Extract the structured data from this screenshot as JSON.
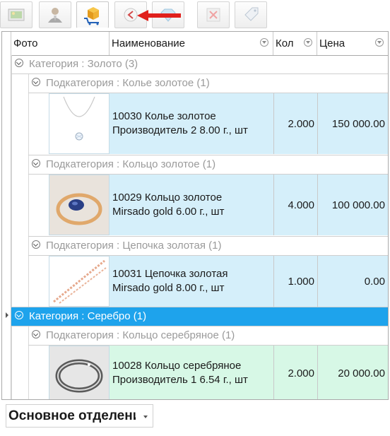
{
  "toolbar": {
    "buttons": [
      {
        "icon": "image-icon"
      },
      {
        "icon": "user-icon"
      },
      {
        "icon": "cart-box-icon",
        "active": true
      },
      {
        "icon": "back-icon"
      },
      {
        "icon": "diamond-icon"
      },
      {
        "icon": "delete-icon"
      },
      {
        "icon": "price-tag-icon"
      }
    ]
  },
  "grid": {
    "columns": [
      "Фото",
      "Наименование",
      "Кол",
      "Цена"
    ],
    "groups": [
      {
        "label": "Категория : Золото (3)",
        "selected": false,
        "subgroups": [
          {
            "label": "Подкатегория : Колье золотое (1)",
            "item": {
              "line1": "10030 Колье золотое",
              "line2": "Производитель 2 8.00 г., шт",
              "qty": "2.000",
              "price": "150 000.00",
              "image": "necklace-image"
            }
          },
          {
            "label": "Подкатегория : Кольцо золотое (1)",
            "item": {
              "line1": "10029 Кольцо золотое",
              "line2": "Mirsado gold 6.00 г., шт",
              "qty": "4.000",
              "price": "100 000.00",
              "image": "gold-ring-image"
            }
          },
          {
            "label": "Подкатегория : Цепочка золотая (1)",
            "item": {
              "line1": "10031 Цепочка золотая",
              "line2": "Mirsado gold 8.00 г., шт",
              "qty": "1.000",
              "price": "0.00",
              "image": "chain-image"
            }
          }
        ]
      },
      {
        "label": "Категория : Серебро (1)",
        "selected": true,
        "subgroups": [
          {
            "label": "Подкатегория : Кольцо серебряное (1)",
            "item": {
              "line1": "10028 Кольцо серебряное",
              "line2": "Производитель 1 6.54 г., шт",
              "qty": "2.000",
              "price": "20 000.00",
              "image": "silver-ring-image"
            }
          }
        ]
      }
    ]
  },
  "department": {
    "value": "Основное отделение"
  },
  "colors": {
    "selected": "#1ea3ec",
    "row_gold": "#d5effa",
    "row_silver": "#d7f8e6",
    "arrow": "#e0201c"
  }
}
